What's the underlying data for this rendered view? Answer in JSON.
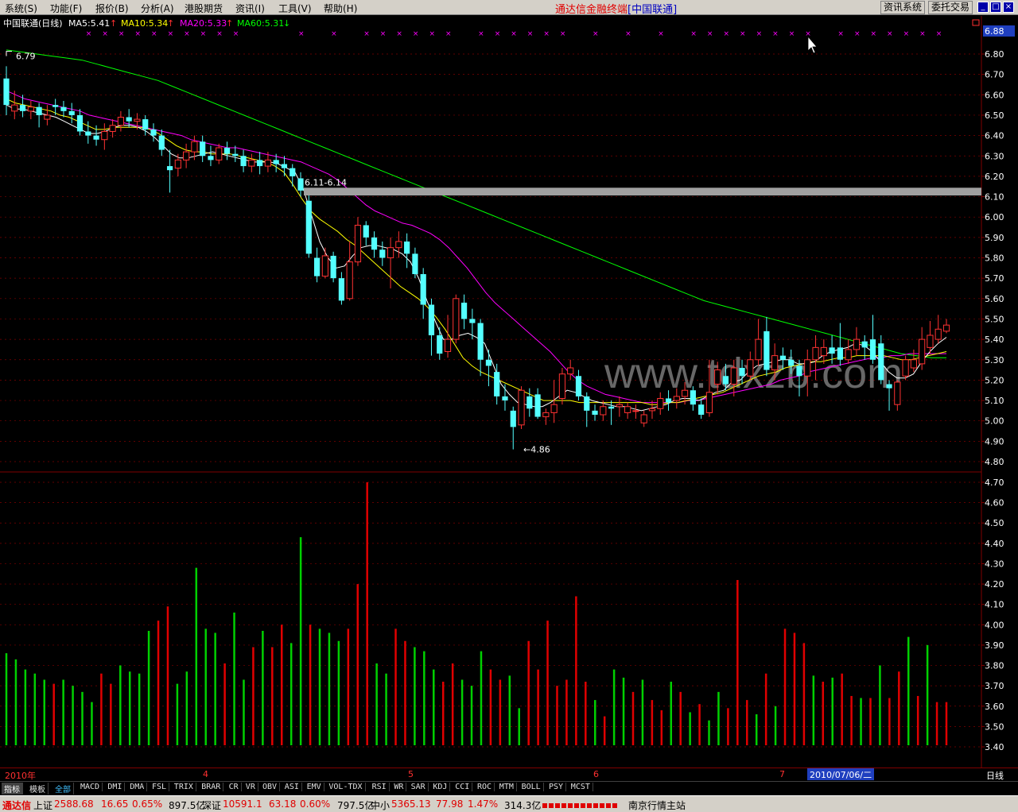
{
  "menu": {
    "items": [
      "系统(S)",
      "功能(F)",
      "报价(B)",
      "分析(A)",
      "港股期货",
      "资讯(I)",
      "工具(V)",
      "帮助(H)"
    ],
    "app_title_prefix": "通达信金融终端",
    "app_title_suffix": "[中国联通]",
    "btn_info": "资讯系统",
    "btn_trade": "委托交易",
    "win_min": "_",
    "win_max": "□",
    "win_close": "×"
  },
  "legend": {
    "name": "中国联通(日线)",
    "ma5": "MA5:5.41",
    "ma10": "MA10:5.34",
    "ma20": "MA20:5.33",
    "ma60": "MA60:5.31",
    "up": "↑",
    "down": "↓",
    "colors": {
      "ma5": "#ffffff",
      "ma10": "#ffff00",
      "ma20": "#ff00ff",
      "ma60": "#00ff00"
    }
  },
  "colors": {
    "bull": "#ff3232",
    "bear": "#54ffff",
    "vol_up": "#e00000",
    "vol_down": "#00d000",
    "grid": "#800000",
    "axis_text": "#ffffff"
  },
  "chart_data": {
    "type": "candlestick",
    "current_price_label": "6.88",
    "price_axis": {
      "ticks": [
        "6.80",
        "6.70",
        "6.60",
        "6.50",
        "6.40",
        "6.30",
        "6.20",
        "6.10",
        "6.00",
        "5.90",
        "5.80",
        "5.70",
        "5.60",
        "5.50",
        "5.40",
        "5.30",
        "5.20",
        "5.10",
        "5.00",
        "4.90",
        "4.80"
      ],
      "min": 4.8,
      "max": 6.8
    },
    "volume_axis": {
      "ticks": [
        "4.70",
        "4.60",
        "4.50",
        "4.40",
        "4.30",
        "4.20",
        "4.10",
        "4.00",
        "3.90",
        "3.80",
        "3.70",
        "3.60",
        "3.50",
        "3.40"
      ]
    },
    "annotations": {
      "high": "6.79",
      "low": "←4.86",
      "resistance": "6.11-6.14"
    },
    "resistance_band": [
      6.11,
      6.14
    ],
    "months": [
      "2010年",
      "4",
      "5",
      "6",
      "7"
    ],
    "selected_date": "2010/07/06/二",
    "period": "日线",
    "candles": [
      [
        6.68,
        6.55,
        6.74,
        6.5
      ],
      [
        6.52,
        6.55,
        6.62,
        6.48
      ],
      [
        6.55,
        6.52,
        6.6,
        6.49
      ],
      [
        6.52,
        6.54,
        6.57,
        6.48
      ],
      [
        6.54,
        6.5,
        6.56,
        6.44
      ],
      [
        6.48,
        6.5,
        6.55,
        6.45
      ],
      [
        6.55,
        6.54,
        6.58,
        6.5
      ],
      [
        6.54,
        6.52,
        6.57,
        6.49
      ],
      [
        6.52,
        6.5,
        6.56,
        6.46
      ],
      [
        6.5,
        6.42,
        6.53,
        6.4
      ],
      [
        6.42,
        6.4,
        6.47,
        6.36
      ],
      [
        6.4,
        6.38,
        6.45,
        6.35
      ],
      [
        6.38,
        6.42,
        6.46,
        6.33
      ],
      [
        6.42,
        6.45,
        6.48,
        6.39
      ],
      [
        6.45,
        6.49,
        6.52,
        6.42
      ],
      [
        6.49,
        6.47,
        6.53,
        6.44
      ],
      [
        6.47,
        6.48,
        6.51,
        6.43
      ],
      [
        6.48,
        6.43,
        6.5,
        6.4
      ],
      [
        6.43,
        6.4,
        6.46,
        6.37
      ],
      [
        6.4,
        6.33,
        6.43,
        6.3
      ],
      [
        6.25,
        6.23,
        6.33,
        6.12
      ],
      [
        6.24,
        6.28,
        6.31,
        6.2
      ],
      [
        6.28,
        6.32,
        6.36,
        6.24
      ],
      [
        6.32,
        6.37,
        6.4,
        6.28
      ],
      [
        6.37,
        6.3,
        6.4,
        6.27
      ],
      [
        6.3,
        6.28,
        6.35,
        6.25
      ],
      [
        6.28,
        6.34,
        6.36,
        6.26
      ],
      [
        6.34,
        6.31,
        6.37,
        6.28
      ],
      [
        6.31,
        6.3,
        6.35,
        6.27
      ],
      [
        6.3,
        6.25,
        6.33,
        6.22
      ],
      [
        6.25,
        6.28,
        6.31,
        6.22
      ],
      [
        6.28,
        6.25,
        6.32,
        6.21
      ],
      [
        6.25,
        6.28,
        6.32,
        6.22
      ],
      [
        6.28,
        6.26,
        6.31,
        6.22
      ],
      [
        6.26,
        6.24,
        6.3,
        6.2
      ],
      [
        6.24,
        6.2,
        6.26,
        6.15
      ],
      [
        6.19,
        6.13,
        6.22,
        6.1
      ],
      [
        6.08,
        5.82,
        6.11,
        5.8
      ],
      [
        5.8,
        5.71,
        5.85,
        5.68
      ],
      [
        5.71,
        5.81,
        5.85,
        5.7
      ],
      [
        5.81,
        5.7,
        5.83,
        5.68
      ],
      [
        5.7,
        5.59,
        5.73,
        5.57
      ],
      [
        5.6,
        5.78,
        5.88,
        5.59
      ],
      [
        5.78,
        5.96,
        6.0,
        5.76
      ],
      [
        5.96,
        5.9,
        5.98,
        5.86
      ],
      [
        5.9,
        5.84,
        5.93,
        5.8
      ],
      [
        5.84,
        5.8,
        5.88,
        5.76
      ],
      [
        5.8,
        5.85,
        5.9,
        5.65
      ],
      [
        5.85,
        5.88,
        5.93,
        5.8
      ],
      [
        5.88,
        5.82,
        5.92,
        5.75
      ],
      [
        5.82,
        5.72,
        5.85,
        5.7
      ],
      [
        5.72,
        5.57,
        5.75,
        5.5
      ],
      [
        5.57,
        5.42,
        5.6,
        5.32
      ],
      [
        5.42,
        5.33,
        5.46,
        5.3
      ],
      [
        5.34,
        5.4,
        5.52,
        5.31
      ],
      [
        5.4,
        5.6,
        5.62,
        5.38
      ],
      [
        5.58,
        5.5,
        5.62,
        5.45
      ],
      [
        5.5,
        5.48,
        5.55,
        5.4
      ],
      [
        5.48,
        5.3,
        5.5,
        5.22
      ],
      [
        5.3,
        5.27,
        5.35,
        5.17
      ],
      [
        5.24,
        5.12,
        5.28,
        5.08
      ],
      [
        5.12,
        5.1,
        5.18,
        5.05
      ],
      [
        5.05,
        4.97,
        5.07,
        4.86
      ],
      [
        4.98,
        5.15,
        5.17,
        4.96
      ],
      [
        5.12,
        5.06,
        5.16,
        5.02
      ],
      [
        5.13,
        5.02,
        5.16,
        5.01
      ],
      [
        5.02,
        5.04,
        5.06,
        4.98
      ],
      [
        5.04,
        5.08,
        5.2,
        4.99
      ],
      [
        5.11,
        5.23,
        5.26,
        5.08
      ],
      [
        5.23,
        5.26,
        5.3,
        5.2
      ],
      [
        5.22,
        5.12,
        5.25,
        5.1
      ],
      [
        5.12,
        5.05,
        5.14,
        4.97
      ],
      [
        5.05,
        5.03,
        5.08,
        5.0
      ],
      [
        5.03,
        5.07,
        5.1,
        5.0
      ],
      [
        5.07,
        5.06,
        5.1,
        4.98
      ],
      [
        5.07,
        5.08,
        5.12,
        5.02
      ],
      [
        5.04,
        5.07,
        5.09,
        5.01
      ],
      [
        5.05,
        5.05,
        5.08,
        5.01
      ],
      [
        4.99,
        5.03,
        5.05,
        4.97
      ],
      [
        5.05,
        5.06,
        5.1,
        5.01
      ],
      [
        5.06,
        5.11,
        5.14,
        5.03
      ],
      [
        5.11,
        5.09,
        5.15,
        5.05
      ],
      [
        5.1,
        5.12,
        5.16,
        5.06
      ],
      [
        5.12,
        5.15,
        5.19,
        5.08
      ],
      [
        5.15,
        5.08,
        5.17,
        5.05
      ],
      [
        5.08,
        5.03,
        5.11,
        5.01
      ],
      [
        5.04,
        5.14,
        5.3,
        5.02
      ],
      [
        5.18,
        5.25,
        5.29,
        5.13
      ],
      [
        5.22,
        5.18,
        5.28,
        5.15
      ],
      [
        5.18,
        5.26,
        5.3,
        5.12
      ],
      [
        5.26,
        5.22,
        5.3,
        5.18
      ],
      [
        5.22,
        5.3,
        5.34,
        5.2
      ],
      [
        5.3,
        5.4,
        5.5,
        5.27
      ],
      [
        5.44,
        5.25,
        5.51,
        5.22
      ],
      [
        5.25,
        5.32,
        5.38,
        5.2
      ],
      [
        5.32,
        5.3,
        5.36,
        5.25
      ],
      [
        5.3,
        5.27,
        5.35,
        5.23
      ],
      [
        5.27,
        5.22,
        5.3,
        5.12
      ],
      [
        5.22,
        5.3,
        5.35,
        5.12
      ],
      [
        5.3,
        5.36,
        5.42,
        5.2
      ],
      [
        5.32,
        5.36,
        5.4,
        5.28
      ],
      [
        5.36,
        5.33,
        5.42,
        5.28
      ],
      [
        5.36,
        5.3,
        5.48,
        5.27
      ],
      [
        5.3,
        5.35,
        5.4,
        5.28
      ],
      [
        5.35,
        5.4,
        5.46,
        5.32
      ],
      [
        5.39,
        5.36,
        5.42,
        5.3
      ],
      [
        5.4,
        5.3,
        5.52,
        5.28
      ],
      [
        5.38,
        5.2,
        5.42,
        5.18
      ],
      [
        5.18,
        5.16,
        5.2,
        5.05
      ],
      [
        5.08,
        5.19,
        5.2,
        5.05
      ],
      [
        5.22,
        5.3,
        5.32,
        5.2
      ],
      [
        5.26,
        5.3,
        5.35,
        5.24
      ],
      [
        5.28,
        5.4,
        5.46,
        5.25
      ],
      [
        5.36,
        5.42,
        5.49,
        5.33
      ],
      [
        5.4,
        5.45,
        5.52,
        5.38
      ],
      [
        5.44,
        5.47,
        5.5,
        5.43
      ]
    ],
    "ma5": [
      6.55,
      6.53,
      6.53,
      6.52,
      6.51,
      6.5,
      6.49,
      6.47,
      6.45,
      6.43,
      6.41,
      6.41,
      6.42,
      6.44,
      6.45,
      6.45,
      6.44,
      6.42,
      6.39,
      6.35,
      6.31,
      6.29,
      6.29,
      6.3,
      6.31,
      6.32,
      6.31,
      6.3,
      6.29,
      6.28,
      6.27,
      6.27,
      6.27,
      6.26,
      6.24,
      6.22,
      6.14,
      6.01,
      5.88,
      5.8,
      5.75,
      5.76,
      5.81,
      5.85,
      5.86,
      5.86,
      5.85,
      5.84,
      5.82,
      5.78,
      5.7,
      5.59,
      5.49,
      5.4,
      5.4,
      5.42,
      5.43,
      5.41,
      5.38,
      5.28,
      5.18,
      5.13,
      5.09,
      5.08,
      5.07,
      5.07,
      5.09,
      5.12,
      5.15,
      5.14,
      5.12,
      5.1,
      5.09,
      5.08,
      5.07,
      5.07,
      5.06,
      5.05,
      5.06,
      5.07,
      5.08,
      5.1,
      5.11,
      5.11,
      5.1,
      5.12,
      5.14,
      5.15,
      5.19,
      5.2,
      5.24,
      5.27,
      5.28,
      5.29,
      5.3,
      5.3,
      5.28,
      5.28,
      5.29,
      5.32,
      5.34,
      5.35,
      5.36,
      5.38,
      5.37,
      5.34,
      5.29,
      5.24,
      5.21,
      5.21,
      5.23,
      5.29,
      5.34,
      5.38,
      5.41
    ],
    "ma10": [
      6.58,
      6.56,
      6.55,
      6.54,
      6.53,
      6.52,
      6.5,
      6.49,
      6.47,
      6.45,
      6.43,
      6.43,
      6.44,
      6.44,
      6.44,
      6.44,
      6.43,
      6.41,
      6.38,
      6.35,
      6.33,
      6.32,
      6.32,
      6.31,
      6.31,
      6.31,
      6.3,
      6.29,
      6.28,
      6.27,
      6.25,
      6.22,
      6.16,
      6.09,
      6.03,
      5.99,
      5.96,
      5.93,
      5.89,
      5.86,
      5.82,
      5.78,
      5.74,
      5.7,
      5.66,
      5.63,
      5.6,
      5.56,
      5.51,
      5.45,
      5.38,
      5.31,
      5.27,
      5.24,
      5.22,
      5.2,
      5.18,
      5.16,
      5.14,
      5.12,
      5.1,
      5.1,
      5.1,
      5.1,
      5.09,
      5.09,
      5.09,
      5.09,
      5.09,
      5.09,
      5.09,
      5.09,
      5.08,
      5.08,
      5.09,
      5.09,
      5.1,
      5.11,
      5.12,
      5.13,
      5.14,
      5.16,
      5.18,
      5.2,
      5.22,
      5.23,
      5.24,
      5.26,
      5.27,
      5.28,
      5.29,
      5.29,
      5.3,
      5.31,
      5.31,
      5.32,
      5.32,
      5.32,
      5.32,
      5.31,
      5.3,
      5.3,
      5.31,
      5.32,
      5.33,
      5.34
    ],
    "ma20": [
      6.62,
      6.6,
      6.58,
      6.57,
      6.56,
      6.55,
      6.54,
      6.53,
      6.52,
      6.5,
      6.49,
      6.48,
      6.47,
      6.46,
      6.45,
      6.44,
      6.43,
      6.42,
      6.41,
      6.4,
      6.38,
      6.37,
      6.36,
      6.35,
      6.34,
      6.34,
      6.33,
      6.32,
      6.31,
      6.3,
      6.29,
      6.28,
      6.27,
      6.25,
      6.23,
      6.21,
      6.18,
      6.14,
      6.1,
      6.06,
      6.03,
      6.01,
      5.99,
      5.97,
      5.96,
      5.94,
      5.92,
      5.89,
      5.85,
      5.8,
      5.75,
      5.69,
      5.63,
      5.58,
      5.54,
      5.5,
      5.46,
      5.42,
      5.38,
      5.34,
      5.29,
      5.24,
      5.2,
      5.17,
      5.15,
      5.13,
      5.12,
      5.11,
      5.1,
      5.09,
      5.09,
      5.09,
      5.09,
      5.09,
      5.1,
      5.1,
      5.11,
      5.12,
      5.13,
      5.14,
      5.15,
      5.16,
      5.17,
      5.18,
      5.2,
      5.21,
      5.22,
      5.24,
      5.25,
      5.26,
      5.27,
      5.28,
      5.29,
      5.3,
      5.31,
      5.31,
      5.32,
      5.32,
      5.33,
      5.33,
      5.33,
      5.33,
      5.33
    ],
    "ma60": [
      6.82,
      6.81,
      6.8,
      6.79,
      6.78,
      6.77,
      6.75,
      6.73,
      6.71,
      6.69,
      6.67,
      6.64,
      6.61,
      6.58,
      6.55,
      6.52,
      6.49,
      6.46,
      6.43,
      6.4,
      6.37,
      6.34,
      6.31,
      6.28,
      6.25,
      6.22,
      6.19,
      6.16,
      6.13,
      6.1,
      6.07,
      6.04,
      6.01,
      5.98,
      5.95,
      5.92,
      5.89,
      5.86,
      5.83,
      5.8,
      5.77,
      5.74,
      5.71,
      5.68,
      5.65,
      5.62,
      5.59,
      5.57,
      5.55,
      5.53,
      5.51,
      5.49,
      5.47,
      5.45,
      5.43,
      5.41,
      5.39,
      5.37,
      5.35,
      5.33,
      5.32,
      5.31,
      5.31
    ],
    "volumes": [
      3.86,
      3.83,
      3.78,
      3.76,
      3.73,
      3.71,
      3.73,
      3.7,
      3.67,
      3.62,
      3.76,
      3.71,
      3.8,
      3.77,
      3.76,
      3.97,
      4.02,
      4.09,
      3.71,
      3.77,
      4.28,
      3.98,
      3.96,
      3.81,
      4.06,
      3.73,
      3.89,
      3.97,
      3.89,
      4.0,
      3.91,
      4.43,
      4.0,
      3.98,
      3.96,
      3.92,
      3.98,
      4.2,
      4.7,
      3.81,
      3.76,
      3.98,
      3.92,
      3.89,
      3.87,
      3.78,
      3.72,
      3.81,
      3.73,
      3.7,
      3.87,
      3.78,
      3.73,
      3.75,
      3.59,
      3.92,
      3.78,
      4.02,
      3.7,
      3.73,
      4.14,
      3.72,
      3.63,
      3.55,
      3.78,
      3.74,
      3.67,
      3.73,
      3.63,
      3.58,
      3.72,
      3.67,
      3.57,
      3.61,
      3.53,
      3.67,
      3.59,
      4.22,
      3.63,
      3.56,
      3.76,
      3.6,
      3.98,
      3.96,
      3.91,
      3.75,
      3.72,
      3.74,
      3.76,
      3.65,
      3.64,
      3.64,
      3.8,
      3.64,
      3.77,
      3.94,
      3.65,
      3.9,
      3.62,
      3.62
    ],
    "volume_up": [
      false,
      false,
      false,
      false,
      false,
      true,
      false,
      false,
      false,
      false,
      true,
      true,
      false,
      false,
      false,
      false,
      true,
      true,
      false,
      false,
      false,
      false,
      false,
      true,
      false,
      false,
      true,
      false,
      true,
      true,
      false,
      false,
      true,
      false,
      false,
      false,
      true,
      true,
      true,
      false,
      false,
      true,
      true,
      false,
      false,
      false,
      true,
      true,
      false,
      false,
      false,
      true,
      true,
      false,
      false,
      true,
      true,
      true,
      true,
      true,
      true,
      true,
      false,
      true,
      false,
      false,
      true,
      false,
      true,
      true,
      false,
      true,
      false,
      true,
      false,
      false,
      true,
      true,
      true,
      false,
      true,
      false,
      true,
      true,
      true,
      false,
      true,
      false,
      true,
      true,
      false,
      true,
      false,
      true,
      true,
      false,
      true,
      false,
      true,
      true,
      true,
      true
    ]
  },
  "indicator_tabs": [
    "指标",
    "模板",
    "全部",
    "MACD",
    "DMI",
    "DMA",
    "FSL",
    "TRIX",
    "BRAR",
    "CR",
    "VR",
    "OBV",
    "ASI",
    "EMV",
    "VOL-TDX",
    "RSI",
    "WR",
    "SAR",
    "KDJ",
    "CCI",
    "ROC",
    "MTM",
    "BOLL",
    "PSY",
    "MCST"
  ],
  "status": {
    "brand": "通达信",
    "sh_label": "上证",
    "sh_value": "2588.68",
    "sh_change": "16.65",
    "sh_pct": "0.65%",
    "sh_amount": "897.5亿",
    "sz_label": "深证",
    "sz_value": "10591.1",
    "sz_change": "63.18",
    "sz_pct": "0.60%",
    "sz_amount": "797.5亿",
    "zx_label": "中小",
    "zx_value": "5365.13",
    "zx_change": "77.98",
    "zx_pct": "1.47%",
    "zx_amount": "314.3亿",
    "server": "南京行情主站"
  },
  "watermark": "www.tdxzb.com"
}
